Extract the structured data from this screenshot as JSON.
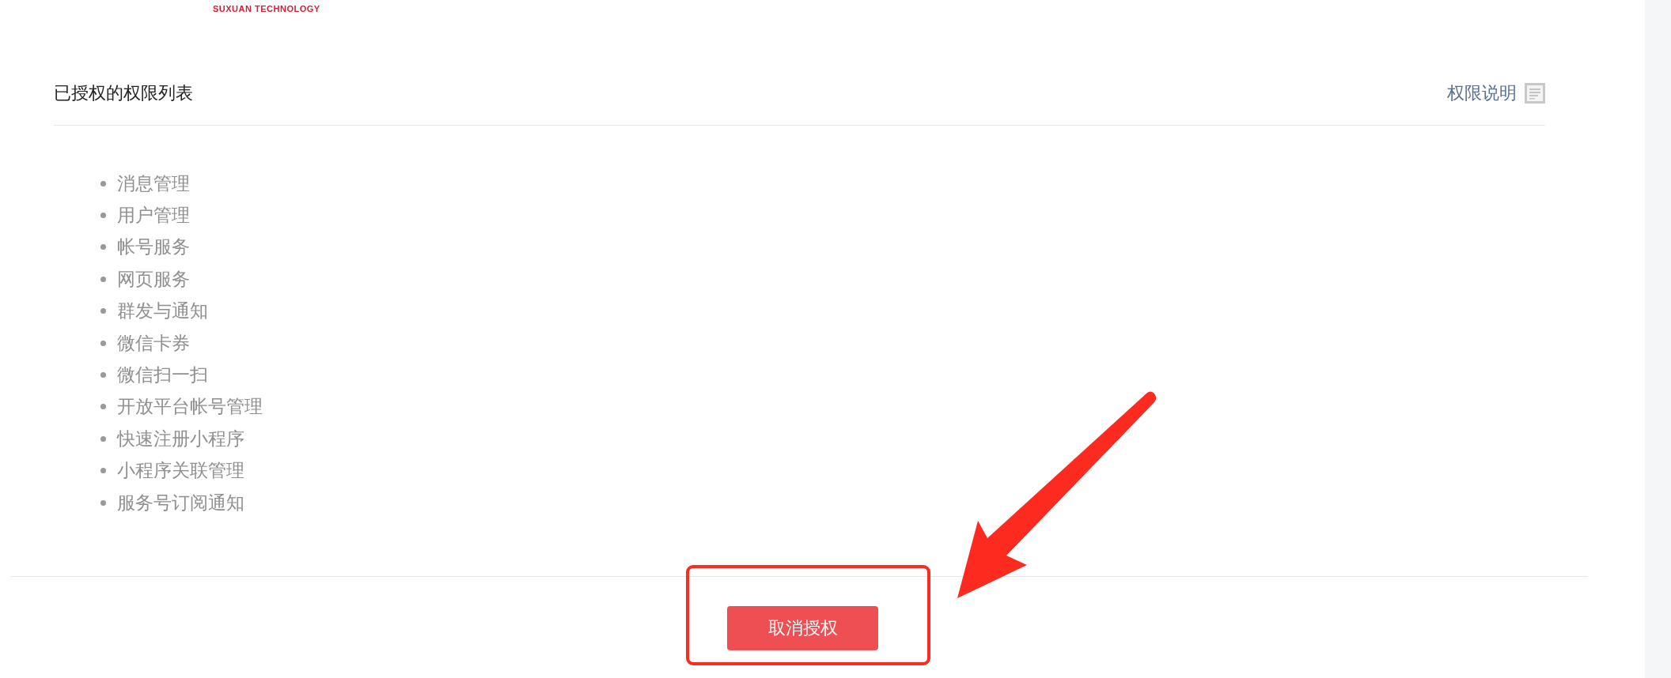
{
  "logo": {
    "text": "SUXUAN TECHNOLOGY"
  },
  "header": {
    "title": "已授权的权限列表",
    "link": "权限说明"
  },
  "permissions": [
    "消息管理",
    "用户管理",
    "帐号服务",
    "网页服务",
    "群发与通知",
    "微信卡券",
    "微信扫一扫",
    "开放平台帐号管理",
    "快速注册小程序",
    "小程序关联管理",
    "服务号订阅通知"
  ],
  "footer": {
    "button": "取消授权"
  },
  "annotations": [
    {
      "kind": "highlight-box"
    },
    {
      "kind": "arrow"
    }
  ]
}
